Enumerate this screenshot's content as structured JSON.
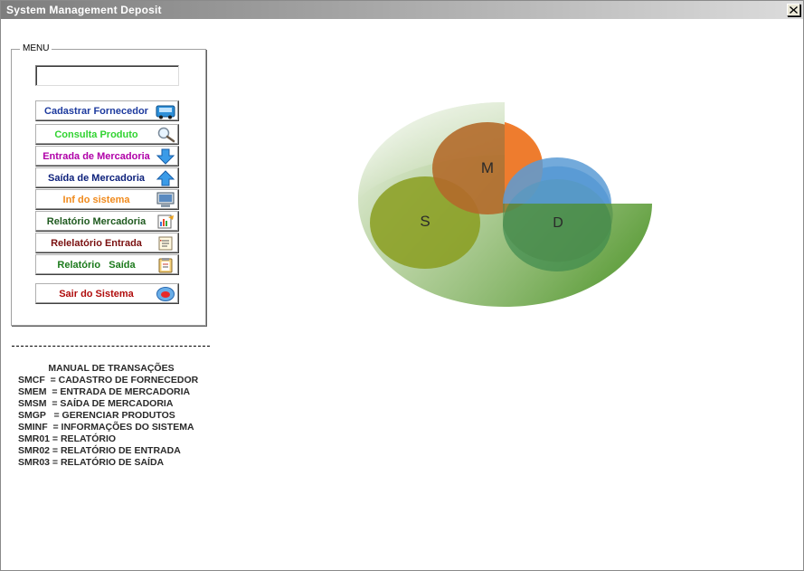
{
  "window": {
    "title": "System Management Deposit"
  },
  "menu": {
    "legend": "MENU",
    "search_value": "",
    "buttons": [
      {
        "label": "Cadastrar Fornecedor",
        "color": "#1d3a9e",
        "icon": "truck-icon"
      },
      {
        "label": "Consulta Produto",
        "color": "#31d331",
        "icon": "magnifier-icon"
      },
      {
        "label": "Entrada de Mercadoria",
        "color": "#b000a8",
        "icon": "arrow-down-icon"
      },
      {
        "label": "Saída de Mercadoria",
        "color": "#0b1f7a",
        "icon": "arrow-up-icon"
      },
      {
        "label": "Inf do sistema",
        "color": "#f08a1c",
        "icon": "computer-icon"
      },
      {
        "label": "Relatório Mercadoria",
        "color": "#1f5a1f",
        "icon": "report-icon"
      },
      {
        "label": "Relelatório Entrada",
        "color": "#7a1010",
        "icon": "list-icon"
      },
      {
        "label": "Relatório   Saída",
        "color": "#1c7a1c",
        "icon": "clipboard-icon"
      },
      {
        "label": "Sair do Sistema",
        "color": "#b00d0d",
        "icon": "exit-icon"
      }
    ]
  },
  "manual": {
    "title": "MANUAL DE TRANSAÇÕES",
    "rows": [
      "SMCF  = CADASTRO DE FORNECEDOR",
      "SMEM  = ENTRADA DE MERCADORIA",
      "SMSM  = SAÍDA DE MERCADORIA",
      "SMGP   = GERENCIAR PRODUTOS",
      "SMINF  = INFORMAÇÕES DO SISTEMA",
      "SMR01 = RELATÓRIO",
      "SMR02 = RELATÓRIO DE ENTRADA",
      "SMR03 = RELATÓRIO DE SAÍDA"
    ]
  },
  "logo": {
    "letters": [
      "M",
      "S",
      "D"
    ],
    "colors": {
      "green": "#5f9e3c",
      "orange": "#f07d2e",
      "blue": "#5b9bd5",
      "olive": "#8aa020"
    }
  }
}
